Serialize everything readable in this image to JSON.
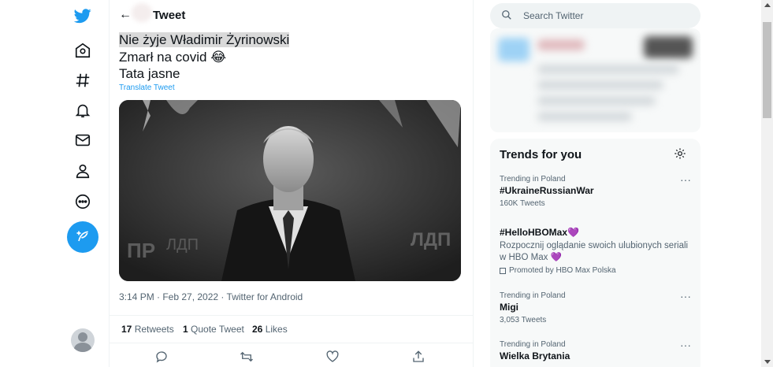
{
  "colors": {
    "accent": "#1d9bf0",
    "text": "#0f1419",
    "muted": "#536471",
    "heart_emoji": "#a46ed6"
  },
  "nav": {
    "icons": [
      "twitter-logo-icon",
      "home-icon",
      "explore-hashtag-icon",
      "notifications-bell-icon",
      "messages-envelope-icon",
      "profile-person-icon",
      "more-circle-icon"
    ],
    "compose_icon": "feather-plus-icon"
  },
  "header": {
    "back_arrow": "←",
    "title": "Tweet"
  },
  "tweet": {
    "line1": "Nie żyje Władimir Żyrinowski",
    "line2": "Zmarł na covid",
    "line2_emoji": "😂",
    "line3": "Tata jasne",
    "translate_link": "Translate Tweet",
    "meta": "3:14 PM · Feb 27, 2022 · Twitter for Android",
    "stats": {
      "retweets_count": "17",
      "retweets_label": "Retweets",
      "quotes_count": "1",
      "quotes_label": "Quote Tweet",
      "likes_count": "26",
      "likes_label": "Likes"
    },
    "media_text": "ЛДП",
    "actions": [
      "reply-icon",
      "retweet-icon",
      "like-heart-icon",
      "share-icon"
    ]
  },
  "search": {
    "placeholder": "Search Twitter"
  },
  "trends": {
    "title": "Trends for you",
    "items": [
      {
        "context": "Trending in Poland",
        "name": "#UkraineRussianWar",
        "count": "160K Tweets",
        "more": "···"
      },
      {
        "name": "#HelloHBOMax",
        "emoji": "💜",
        "description": "Rozpocznij oglądanie swoich ulubionych seriali w HBO Max",
        "description_emoji": "💜",
        "promoted": "Promoted by HBO Max Polska"
      },
      {
        "context": "Trending in Poland",
        "name": "Migi",
        "count": "3,053 Tweets",
        "more": "···"
      },
      {
        "context": "Trending in Poland",
        "name": "Wielka Brytania",
        "more": "···"
      }
    ]
  }
}
